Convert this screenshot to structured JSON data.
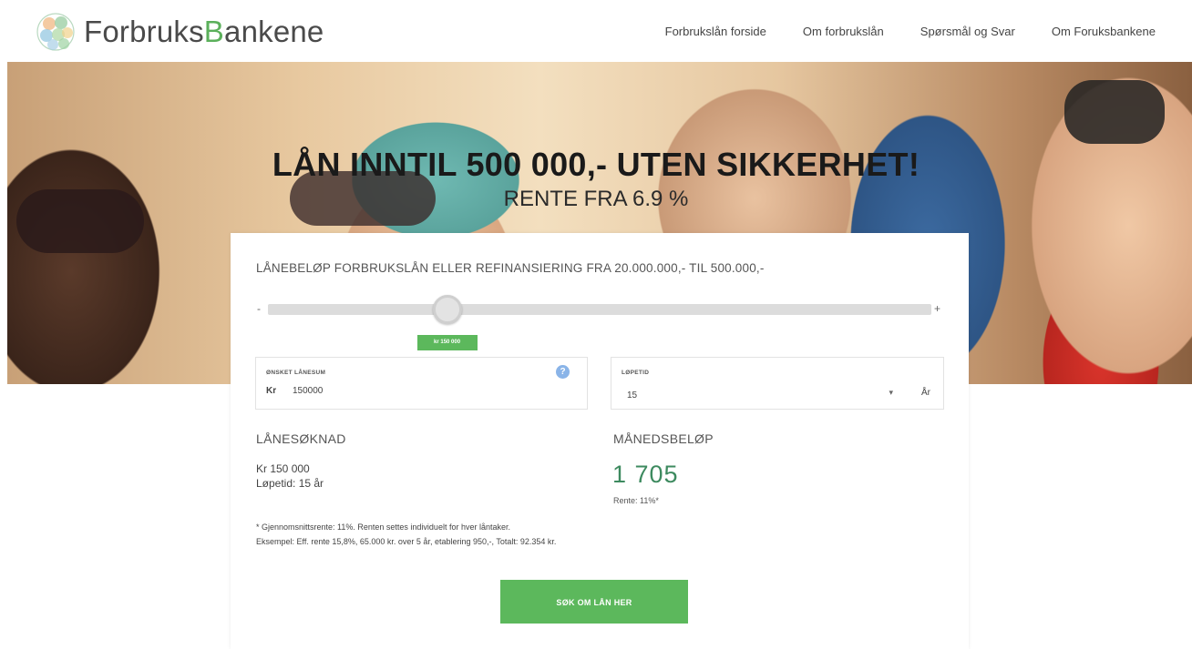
{
  "header": {
    "logo_text_a": "Forbruks",
    "logo_text_b": "B",
    "logo_text_c": "ankene",
    "nav": [
      "Forbrukslån forside",
      "Om forbrukslån",
      "Spørsmål og Svar",
      "Om Foruksbankene"
    ]
  },
  "hero": {
    "title": "LÅN INNTIL 500 000,- UTEN SIKKERHET!",
    "subtitle": "RENTE FRA 6.9 %"
  },
  "form": {
    "heading": "LÅNEBELØP FORBRUKSLÅN ELLER REFINANSIERING FRA 20.000.000,- TIL 500.000,-",
    "slider": {
      "minus": "-",
      "plus": "+",
      "tooltip": "kr 150 000",
      "value_fraction": 0.27
    },
    "amount_field": {
      "label": "ØNSKET LÅNESUM",
      "prefix": "Kr",
      "value": "150000",
      "help": "?"
    },
    "term_field": {
      "label": "LØPETID",
      "value": "15",
      "caret": "▾",
      "unit": "År"
    },
    "application": {
      "title": "LÅNESØKNAD",
      "amount": "Kr 150 000",
      "term": "Løpetid: 15 år"
    },
    "monthly": {
      "title": "MÅNEDSBELØP",
      "value": "1 705",
      "rate": "Rente: 11%*"
    },
    "footnote_1": "* Gjennomsnittsrente: 11%. Renten settes individuelt for hver låntaker.",
    "footnote_2": "Eksempel: Eff. rente 15,8%, 65.000 kr. over 5 år, etablering 950,-, Totalt: 92.354 kr.",
    "button_label": "SØK OM LÅN HER"
  },
  "colors": {
    "accent_green": "#5cb85c",
    "monthly_green": "#3d8a5f"
  }
}
